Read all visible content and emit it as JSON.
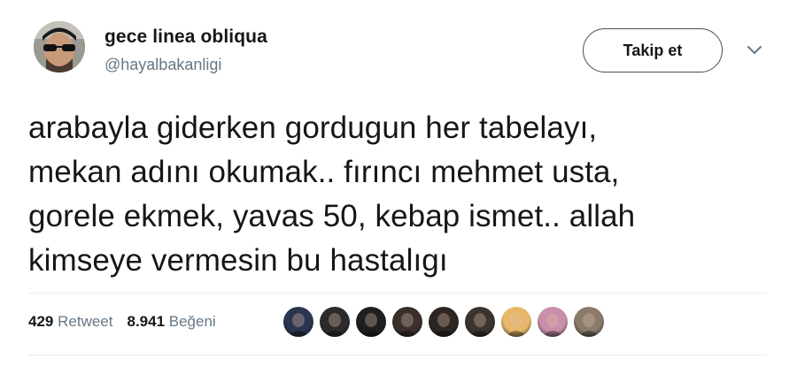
{
  "user": {
    "display_name": "gece linea obliqua",
    "handle": "@hayalbakanligi",
    "avatar_icon": "user-avatar"
  },
  "follow_button": {
    "label": "Takip et"
  },
  "menu": {
    "icon": "chevron-down-icon"
  },
  "tweet": {
    "text": "arabayla giderken gordugun her tabelayı,\nmekan adını okumak.. fırıncı mehmet usta,\ngorele ekmek, yavas 50, kebap ismet.. allah\nkimseye vermesin bu hastalıgı"
  },
  "stats": {
    "retweets": {
      "count": "429",
      "label": "Retweet"
    },
    "likes": {
      "count": "8.941",
      "label": "Beğeni"
    }
  },
  "likers": [
    {
      "color": "#2a3550"
    },
    {
      "color": "#2b2b2b"
    },
    {
      "color": "#1f1f1f"
    },
    {
      "color": "#3a2f2c"
    },
    {
      "color": "#2c2522"
    },
    {
      "color": "#3b342e"
    },
    {
      "color": "#e7b86a"
    },
    {
      "color": "#c98ea8"
    },
    {
      "color": "#8a7a6c"
    }
  ],
  "colors": {
    "text": "#14171a",
    "muted": "#657786",
    "divider": "#e6ecf0"
  }
}
